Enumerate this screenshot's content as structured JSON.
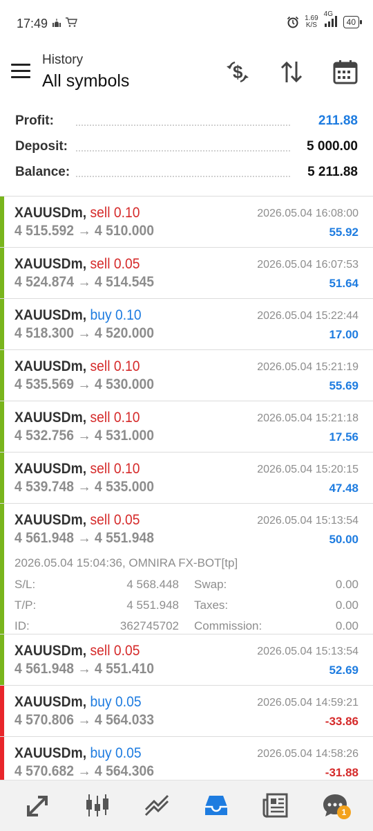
{
  "status_bar": {
    "time": "17:49",
    "left_icons": [
      "mosque-icon",
      "shopping-cart-icon"
    ],
    "alarm_icon": "alarm-icon",
    "speed_value": "1.69",
    "speed_unit": "K/S",
    "network": "4G",
    "battery": "40"
  },
  "header": {
    "subtitle": "History",
    "title": "All symbols",
    "icons": [
      "menu-icon",
      "currency-exchange-icon",
      "sort-icon",
      "calendar-icon"
    ]
  },
  "summary": {
    "profit_label": "Profit:",
    "profit_value": "211.88",
    "deposit_label": "Deposit:",
    "deposit_value": "5 000.00",
    "balance_label": "Balance:",
    "balance_value": "5 211.88",
    "profit_color": "#1e7ce0"
  },
  "trades": [
    {
      "symbol": "XAUUSDm",
      "side": "sell",
      "volume": "0.10",
      "open": "4 515.592",
      "arrow": "→",
      "close": "4 510.000",
      "date": "2026.05.04 16:08:00",
      "profit": "55.92",
      "result": "win"
    },
    {
      "symbol": "XAUUSDm",
      "side": "sell",
      "volume": "0.05",
      "open": "4 524.874",
      "arrow": "→",
      "close": "4 514.545",
      "date": "2026.05.04 16:07:53",
      "profit": "51.64",
      "result": "win"
    },
    {
      "symbol": "XAUUSDm",
      "side": "buy",
      "volume": "0.10",
      "open": "4 518.300",
      "arrow": "→",
      "close": "4 520.000",
      "date": "2026.05.04 15:22:44",
      "profit": "17.00",
      "result": "win"
    },
    {
      "symbol": "XAUUSDm",
      "side": "sell",
      "volume": "0.10",
      "open": "4 535.569",
      "arrow": "→",
      "close": "4 530.000",
      "date": "2026.05.04 15:21:19",
      "profit": "55.69",
      "result": "win"
    },
    {
      "symbol": "XAUUSDm",
      "side": "sell",
      "volume": "0.10",
      "open": "4 532.756",
      "arrow": "→",
      "close": "4 531.000",
      "date": "2026.05.04 15:21:18",
      "profit": "17.56",
      "result": "win"
    },
    {
      "symbol": "XAUUSDm",
      "side": "sell",
      "volume": "0.10",
      "open": "4 539.748",
      "arrow": "→",
      "close": "4 535.000",
      "date": "2026.05.04 15:20:15",
      "profit": "47.48",
      "result": "win"
    },
    {
      "symbol": "XAUUSDm",
      "side": "sell",
      "volume": "0.05",
      "open": "4 561.948",
      "arrow": "→",
      "close": "4 551.948",
      "date": "2026.05.04 15:13:54",
      "profit": "50.00",
      "result": "win",
      "details": {
        "comment": "2026.05.04 15:04:36, OMNIRA FX-BOT[tp]",
        "sl_label": "S/L:",
        "sl_value": "4 568.448",
        "tp_label": "T/P:",
        "tp_value": "4 551.948",
        "id_label": "ID:",
        "id_value": "362745702",
        "swap_label": "Swap:",
        "swap_value": "0.00",
        "taxes_label": "Taxes:",
        "taxes_value": "0.00",
        "commission_label": "Commission:",
        "commission_value": "0.00"
      }
    },
    {
      "symbol": "XAUUSDm",
      "side": "sell",
      "volume": "0.05",
      "open": "4 561.948",
      "arrow": "→",
      "close": "4 551.410",
      "date": "2026.05.04 15:13:54",
      "profit": "52.69",
      "result": "win"
    },
    {
      "symbol": "XAUUSDm",
      "side": "buy",
      "volume": "0.05",
      "open": "4 570.806",
      "arrow": "→",
      "close": "4 564.033",
      "date": "2026.05.04 14:59:21",
      "profit": "-33.86",
      "result": "loss"
    },
    {
      "symbol": "XAUUSDm",
      "side": "buy",
      "volume": "0.05",
      "open": "4 570.682",
      "arrow": "→",
      "close": "4 564.306",
      "date": "2026.05.04 14:58:26",
      "profit": "-31.88",
      "result": "loss"
    }
  ],
  "bottom_nav": {
    "items": [
      "quotes-icon",
      "chart-icon",
      "trade-icon",
      "history-icon",
      "news-icon",
      "messages-icon"
    ],
    "active": "history-icon",
    "messages_badge": "1",
    "active_color": "#1e7ce0",
    "badge_color": "#f3a21c"
  },
  "colors": {
    "sell": "#d52a2a",
    "buy": "#1e7ce0",
    "win_bar": "#79b51c",
    "loss_bar": "#e8262b",
    "profit_positive": "#1e7ce0",
    "profit_negative": "#d52a2a"
  }
}
